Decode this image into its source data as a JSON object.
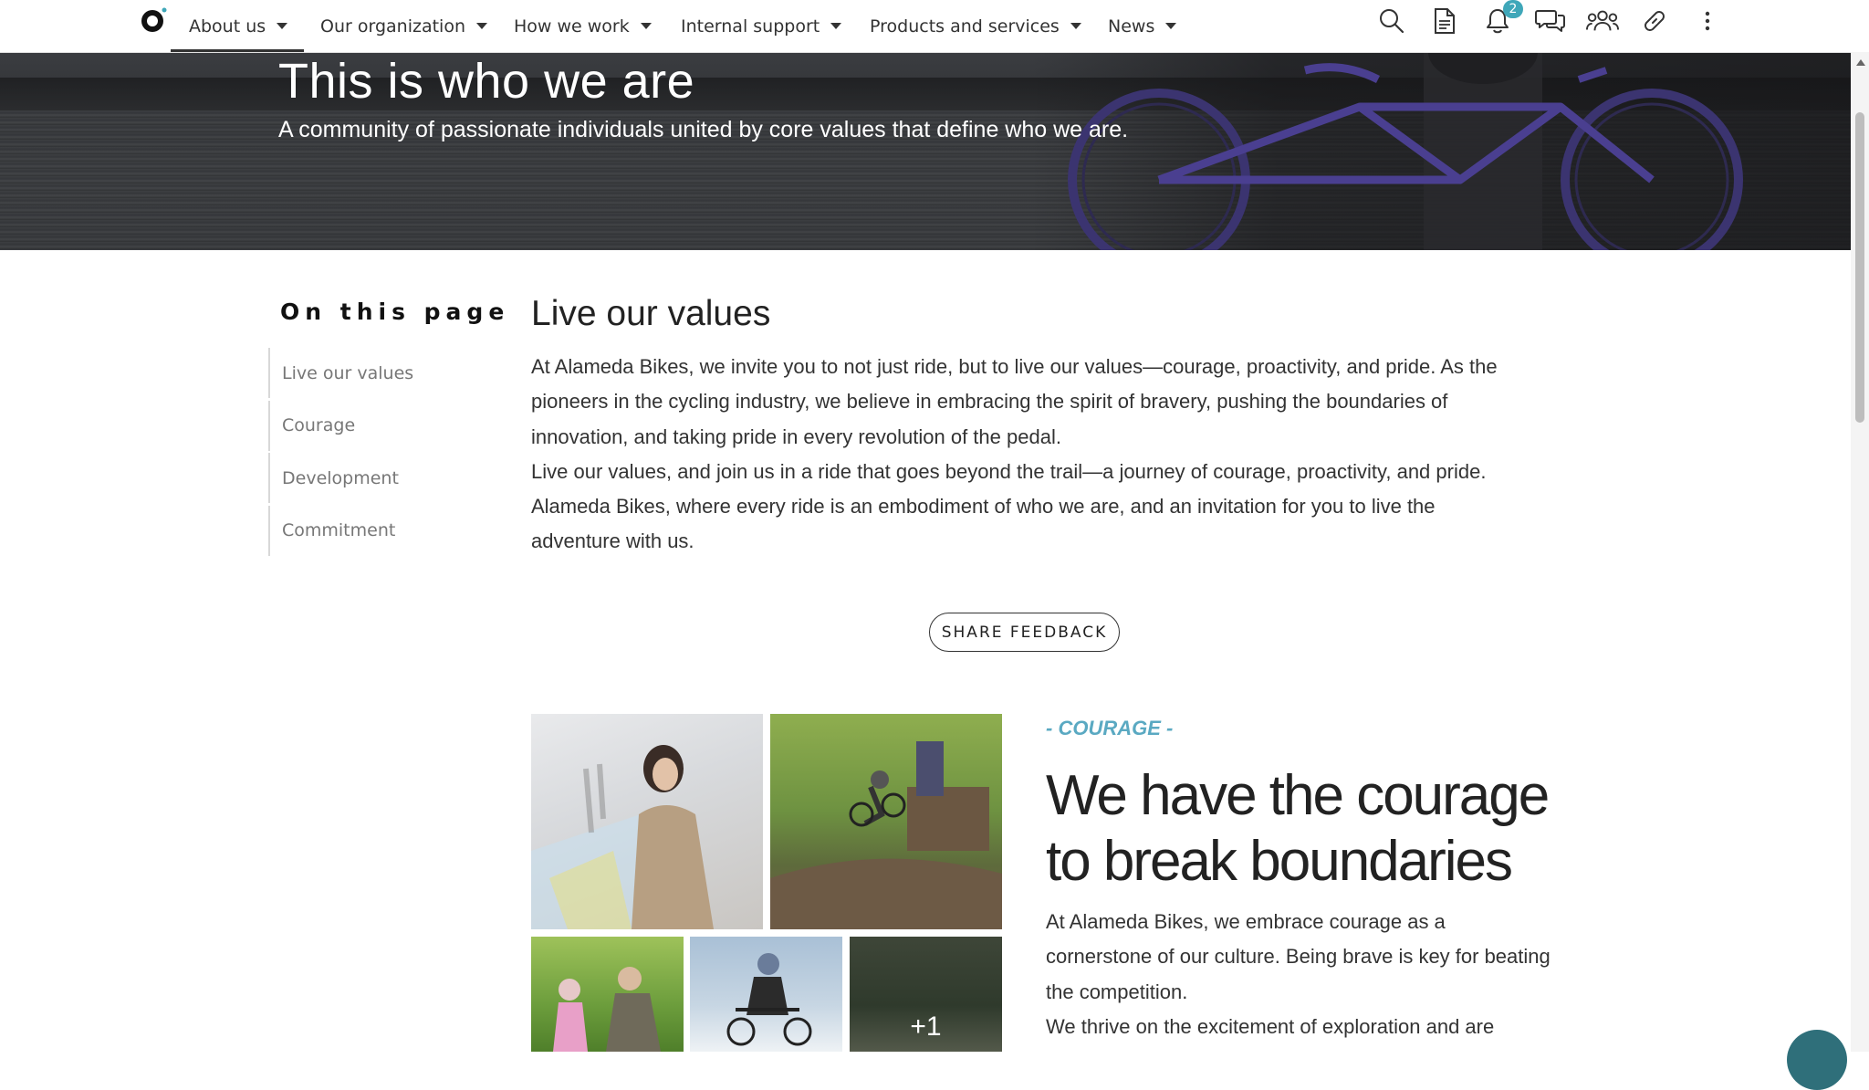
{
  "nav": {
    "items": [
      {
        "label": "About us"
      },
      {
        "label": "Our organization"
      },
      {
        "label": "How we work"
      },
      {
        "label": "Internal support"
      },
      {
        "label": "Products and services"
      },
      {
        "label": "News"
      }
    ],
    "notification_count": "2",
    "tools": [
      "search-icon",
      "document-icon",
      "bell-icon",
      "chat-icon",
      "people-icon",
      "link-icon",
      "more-vertical-icon"
    ]
  },
  "hero": {
    "title": "This is who we are",
    "subtitle": "A community of passionate individuals united by core values that define who we are."
  },
  "on_this_page": {
    "title": "On this page",
    "items": [
      {
        "label": "Live our values"
      },
      {
        "label": "Courage"
      },
      {
        "label": "Development"
      },
      {
        "label": "Commitment"
      }
    ]
  },
  "main": {
    "title": "Live our values",
    "paragraph1": "At Alameda Bikes, we invite you to not just ride, but to live our values—courage, proactivity, and pride. As the pioneers in the cycling industry, we believe in embracing the spirit of bravery, pushing the boundaries of innovation, and taking pride in every revolution of the pedal.",
    "paragraph2": "Live our values, and join us in a ride that goes beyond the trail—a journey of courage, proactivity, and pride. Alameda Bikes, where every ride is an embodiment of who we are, and an invitation for you to live the adventure with us.",
    "feedback_button": "SHARE FEEDBACK"
  },
  "gallery": {
    "more_count": "+1"
  },
  "courage": {
    "label": "- COURAGE -",
    "heading": "We have the courage to break boundaries",
    "paragraph1": "At Alameda Bikes, we embrace courage as a cornerstone of our culture. Being brave is key for beating the competition.",
    "paragraph2": "We thrive on the excitement of exploration and are"
  },
  "colors": {
    "accent": "#5aa9c2",
    "badge": "#3fa7b9",
    "text": "#222222"
  }
}
